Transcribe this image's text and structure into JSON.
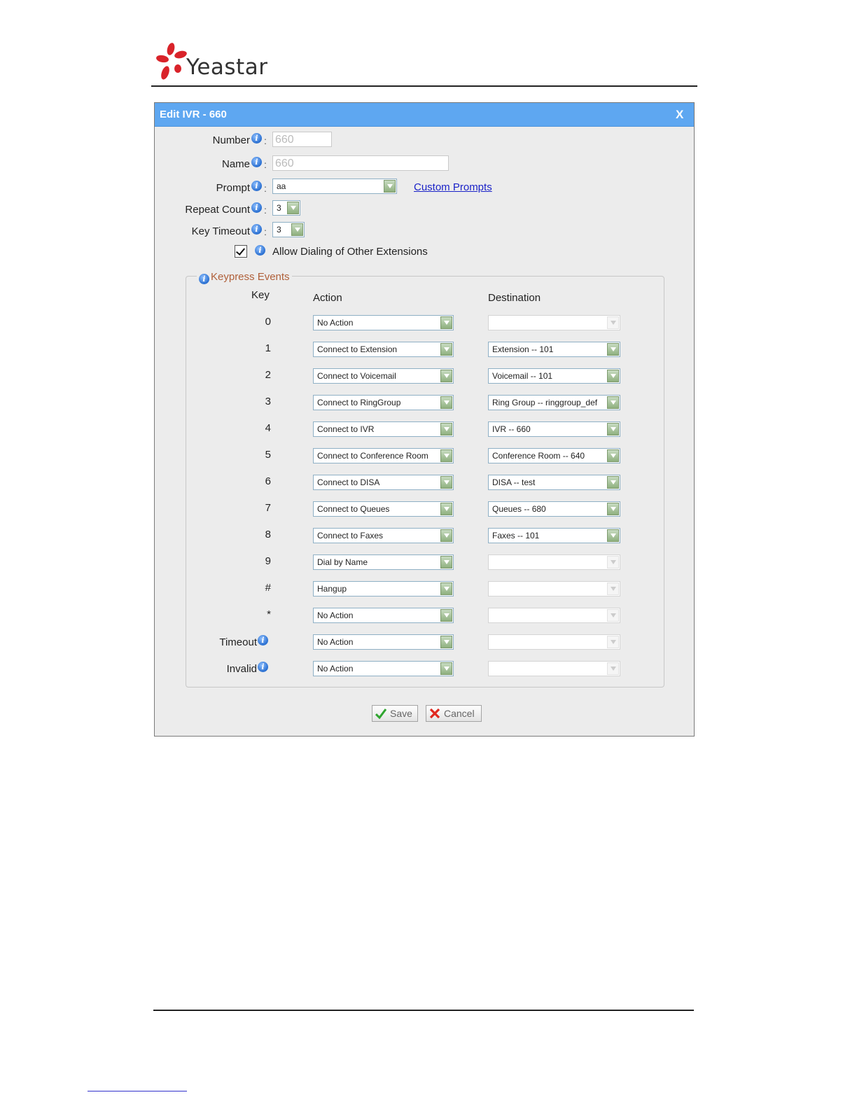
{
  "brand": {
    "logo_text": "Yeastar"
  },
  "dialog": {
    "title": "Edit IVR - 660",
    "close_label": "X",
    "number": {
      "label": "Number",
      "value": "660"
    },
    "name": {
      "label": "Name",
      "value": "660"
    },
    "prompt": {
      "label": "Prompt",
      "value": "aa",
      "link": "Custom Prompts"
    },
    "repeat_count": {
      "label": "Repeat Count",
      "value": "3"
    },
    "key_timeout": {
      "label": "Key Timeout",
      "value": "3"
    },
    "allow_dialing": {
      "label": "Allow Dialing of Other Extensions",
      "checked": true
    },
    "keypress": {
      "legend": "Keypress Events",
      "col_key": "Key",
      "col_action": "Action",
      "col_destination": "Destination",
      "rows": [
        {
          "key": "0",
          "action": "No Action",
          "destination": ""
        },
        {
          "key": "1",
          "action": "Connect to Extension",
          "destination": "Extension -- 101"
        },
        {
          "key": "2",
          "action": "Connect to Voicemail",
          "destination": "Voicemail -- 101"
        },
        {
          "key": "3",
          "action": "Connect to RingGroup",
          "destination": "Ring Group -- ringgroup_def"
        },
        {
          "key": "4",
          "action": "Connect to IVR",
          "destination": "IVR -- 660"
        },
        {
          "key": "5",
          "action": "Connect to Conference Room",
          "destination": "Conference Room -- 640"
        },
        {
          "key": "6",
          "action": "Connect to DISA",
          "destination": "DISA -- test"
        },
        {
          "key": "7",
          "action": "Connect to Queues",
          "destination": "Queues -- 680"
        },
        {
          "key": "8",
          "action": "Connect to Faxes",
          "destination": "Faxes -- 101"
        },
        {
          "key": "9",
          "action": "Dial by Name",
          "destination": ""
        },
        {
          "key": "#",
          "action": "Hangup",
          "destination": ""
        },
        {
          "key": "*",
          "action": "No Action",
          "destination": ""
        },
        {
          "key": "Timeout",
          "action": "No Action",
          "destination": ""
        },
        {
          "key": "Invalid",
          "action": "No Action",
          "destination": ""
        }
      ]
    },
    "save_label": "Save",
    "cancel_label": "Cancel"
  },
  "colors": {
    "titlebar": "#5ea7f1",
    "link": "#1a22c8",
    "legend": "#b0603a",
    "logo_red": "#d9232a"
  },
  "icons": [
    "info-icon",
    "dropdown-arrow-icon",
    "checkmark-icon",
    "cancel-x-icon",
    "close-icon"
  ]
}
